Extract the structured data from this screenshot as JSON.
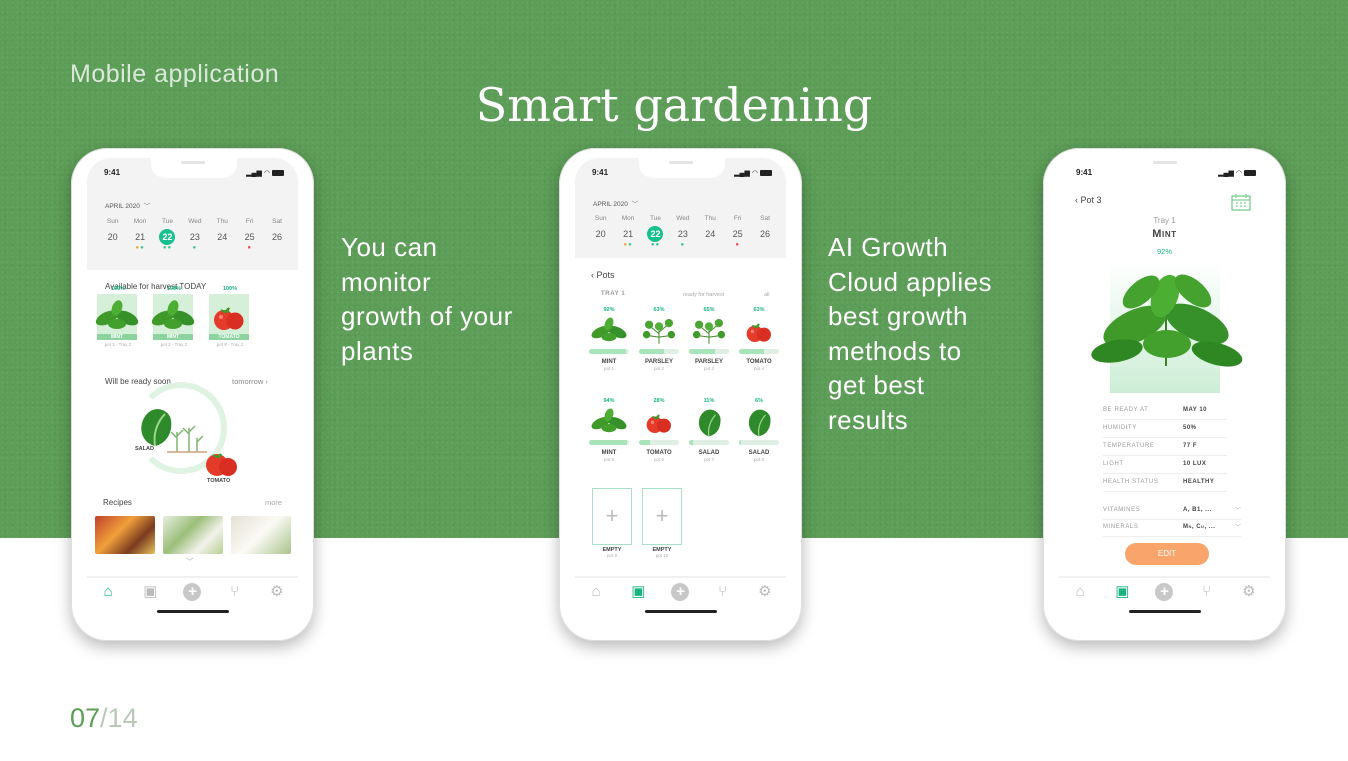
{
  "header": {
    "kicker": "Mobile application",
    "title": "Smart gardening"
  },
  "copy": {
    "left": [
      "You can",
      "monitor",
      "growth of your",
      "plants"
    ],
    "right": [
      "AI Growth",
      "Cloud applies",
      "best growth",
      "methods to",
      "get best",
      "results"
    ]
  },
  "pager": {
    "current": "07",
    "separator": "/",
    "total": "14"
  },
  "status": {
    "time": "9:41"
  },
  "calendar": {
    "month": "APRIL 2020",
    "days": [
      {
        "name": "Sun",
        "num": "20",
        "dots": ""
      },
      {
        "name": "Mon",
        "num": "21",
        "dots": "og"
      },
      {
        "name": "Tue",
        "num": "22",
        "dots": "gg",
        "selected": true
      },
      {
        "name": "Wed",
        "num": "23",
        "dots": "g"
      },
      {
        "name": "Thu",
        "num": "24",
        "dots": ""
      },
      {
        "name": "Fri",
        "num": "25",
        "dots": "r"
      },
      {
        "name": "Sat",
        "num": "26",
        "dots": ""
      }
    ]
  },
  "phone1": {
    "harvest_title": "Available for harvest TODAY",
    "harvest": [
      {
        "pct": "100%",
        "name": "MINT",
        "sub": "pot 1 - Tray 2",
        "kind": "mint"
      },
      {
        "pct": "100%",
        "name": "MINT",
        "sub": "pot 2 - Tray 2",
        "kind": "mint"
      },
      {
        "pct": "100%",
        "name": "TOMATO",
        "sub": "pot 8 - Tray 1",
        "kind": "tomato"
      }
    ],
    "soon_title": "Will be ready soon",
    "soon_link": "tomorrow",
    "soon_labels": {
      "salad": "SALAD",
      "tomato": "TOMATO"
    },
    "recipes_title": "Recipes",
    "recipes_more": "more"
  },
  "phone2": {
    "back_label": "Pots",
    "tray": "TRAY 1",
    "filter_ready": "ready for harvest",
    "filter_all": "all",
    "pots": [
      {
        "pct": "92%",
        "fill": 92,
        "name": "MINT",
        "sub": "pot 1",
        "kind": "mint"
      },
      {
        "pct": "63%",
        "fill": 63,
        "name": "PARSLEY",
        "sub": "pot 2",
        "kind": "parsley"
      },
      {
        "pct": "65%",
        "fill": 65,
        "name": "PARSLEY",
        "sub": "pot 3",
        "kind": "parsley"
      },
      {
        "pct": "63%",
        "fill": 63,
        "name": "TOMATO",
        "sub": "pot 4",
        "kind": "tomato"
      },
      {
        "pct": "94%",
        "fill": 94,
        "name": "MINT",
        "sub": "pot 5",
        "kind": "mint"
      },
      {
        "pct": "28%",
        "fill": 28,
        "name": "TOMATO",
        "sub": "pot 6",
        "kind": "tomato"
      },
      {
        "pct": "11%",
        "fill": 11,
        "name": "SALAD",
        "sub": "pot 7",
        "kind": "salad"
      },
      {
        "pct": "6%",
        "fill": 6,
        "name": "SALAD",
        "sub": "pot 8",
        "kind": "salad"
      }
    ],
    "empty": [
      {
        "name": "EMPTY",
        "sub": "pot 9"
      },
      {
        "name": "EMPTY",
        "sub": "pot 10"
      }
    ]
  },
  "phone3": {
    "back_label": "Pot 3",
    "tray": "Tray 1",
    "plant": "Mint",
    "pct": "92%",
    "details": [
      {
        "k": "BE READY AT",
        "v": "MAY 10"
      },
      {
        "k": "HUMIDITY",
        "v": "50%"
      },
      {
        "k": "TEMPERATURE",
        "v": "77 F"
      },
      {
        "k": "LIGHT",
        "v": "10 LUX"
      },
      {
        "k": "HEALTH STATUS",
        "v": "HEALTHY"
      }
    ],
    "extras": [
      {
        "k": "VITAMINES",
        "v": "A, B1, ..."
      },
      {
        "k": "MINERALS",
        "v": "Mn, Cu, ..."
      }
    ],
    "edit": "EDIT"
  },
  "colors": {
    "band": "#5c9d57",
    "accent": "#18c08f",
    "edit": "#f9a46b",
    "leaf": "#3f9a2a",
    "tomato": "#e43b2a"
  },
  "icons": {
    "home": "home-icon",
    "pots": "pots-icon",
    "add": "add-icon",
    "recipes": "fork-knife-icon",
    "settings": "gear-icon",
    "calendar": "calendar-icon"
  }
}
